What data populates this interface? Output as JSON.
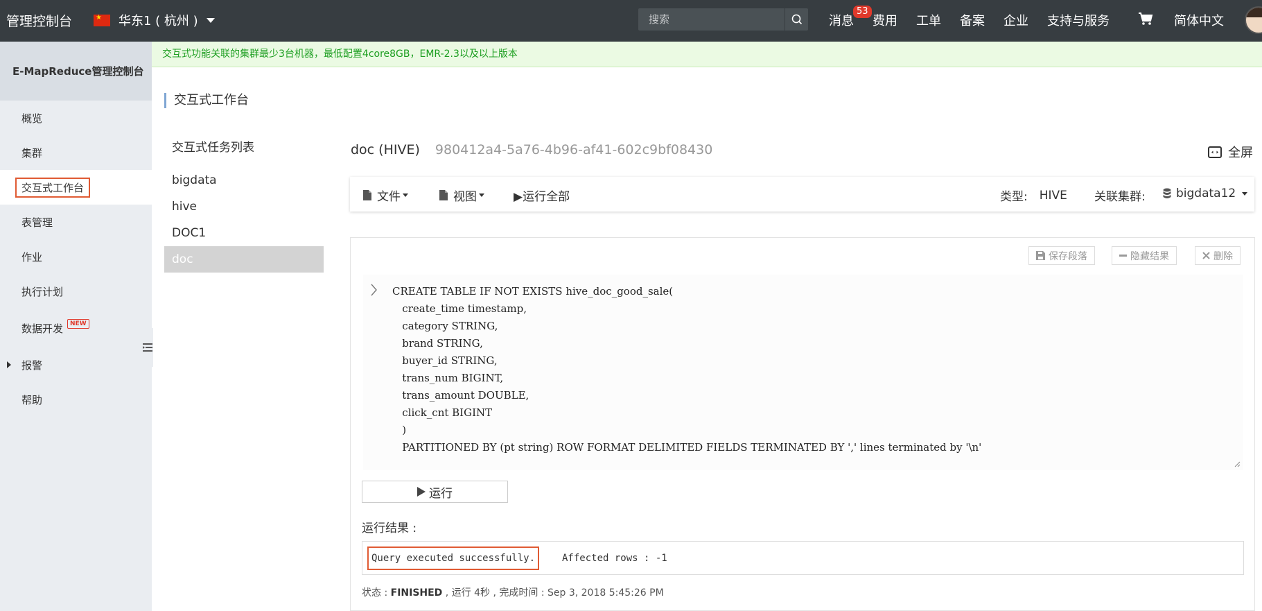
{
  "topbar": {
    "brand": "管理控制台",
    "region": "华东1 ( 杭州 )",
    "search_placeholder": "搜索",
    "nav": [
      {
        "label": "消息",
        "badge": "53"
      },
      {
        "label": "费用"
      },
      {
        "label": "工单"
      },
      {
        "label": "备案"
      },
      {
        "label": "企业"
      },
      {
        "label": "支持与服务"
      }
    ],
    "language": "简体中文"
  },
  "sidebar": {
    "title": "E-MapReduce管理控制台",
    "items": [
      {
        "label": "概览"
      },
      {
        "label": "集群"
      },
      {
        "label": "交互式工作台",
        "active": true
      },
      {
        "label": "表管理"
      },
      {
        "label": "作业"
      },
      {
        "label": "执行计划"
      },
      {
        "label": "数据开发",
        "badge": "NEW"
      },
      {
        "label": "报警",
        "expandable": true
      },
      {
        "label": "帮助"
      }
    ]
  },
  "notice": "交互式功能关联的集群最少3台机器，最低配置4core8GB，EMR-2.3以及以上版本",
  "page_title": "交互式工作台",
  "task_list": {
    "title": "交互式任务列表",
    "items": [
      "bigdata",
      "hive",
      "DOC1",
      "doc"
    ],
    "selected": "doc"
  },
  "doc": {
    "name": "doc (HIVE)",
    "id": "980412a4-5a76-4b96-af41-602c9bf08430",
    "fullscreen_label": "全屏"
  },
  "toolbar": {
    "file_label": "文件",
    "view_label": "视图",
    "run_all_label": "▶运行全部",
    "type_label": "类型:",
    "type_value": "HIVE",
    "cluster_label": "关联集群:",
    "cluster_value": "bigdata12"
  },
  "paragraph": {
    "save_label": "保存段落",
    "hide_label": "隐藏结果",
    "delete_label": "删除",
    "code": "CREATE TABLE IF NOT EXISTS hive_doc_good_sale(\n   create_time timestamp,\n   category STRING,\n   brand STRING,\n   buyer_id STRING,\n   trans_num BIGINT,\n   trans_amount DOUBLE,\n   click_cnt BIGINT\n   )\n   PARTITIONED BY (pt string) ROW FORMAT DELIMITED FIELDS TERMINATED BY ',' lines terminated by '\\n'",
    "run_label": "运行",
    "result_label": "运行结果 :",
    "result_message": "Query executed successfully.",
    "result_rows": "Affected rows : -1",
    "status_prefix": "状态 : ",
    "status_value": "FINISHED",
    "status_rest": " ,  运行 4秒 , 完成时间 : Sep 3, 2018 5:45:26 PM"
  },
  "colors": {
    "topbar_bg": "#373d41",
    "highlight": "#e05b34",
    "notice_text": "#1c9e20",
    "badge": "#e0392b"
  }
}
